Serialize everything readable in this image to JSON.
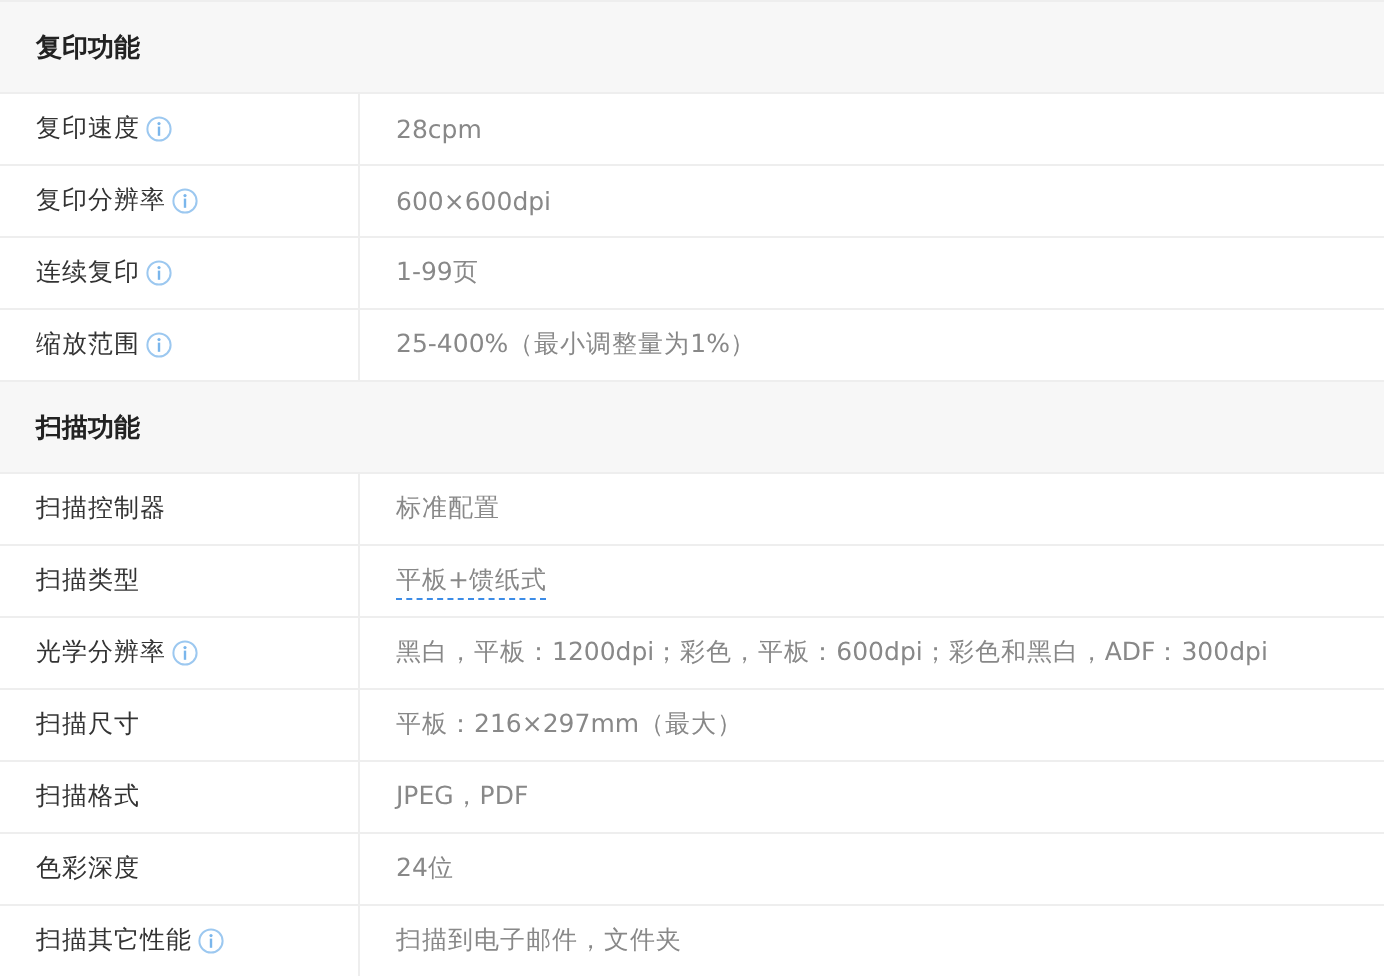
{
  "sections": [
    {
      "title": "复印功能",
      "rows": [
        {
          "label": "复印速度",
          "info": true,
          "kind": "text",
          "value": "28cpm"
        },
        {
          "label": "复印分辨率",
          "info": true,
          "kind": "text",
          "value": "600×600dpi"
        },
        {
          "label": "连续复印",
          "info": true,
          "kind": "text",
          "value": "1-99页"
        },
        {
          "label": "缩放范围",
          "info": true,
          "kind": "text",
          "value": "25-400%（最小调整量为1%）"
        }
      ]
    },
    {
      "title": "扫描功能",
      "rows": [
        {
          "label": "扫描控制器",
          "info": false,
          "kind": "text",
          "value": "标准配置"
        },
        {
          "label": "扫描类型",
          "info": false,
          "kind": "link",
          "value": "平板+馈纸式"
        },
        {
          "label": "光学分辨率",
          "info": true,
          "kind": "text",
          "value": "黑白，平板：1200dpi；彩色，平板：600dpi；彩色和黑白，ADF：300dpi"
        },
        {
          "label": "扫描尺寸",
          "info": false,
          "kind": "text",
          "value": "平板：216×297mm（最大）"
        },
        {
          "label": "扫描格式",
          "info": false,
          "kind": "text",
          "value": "JPEG，PDF"
        },
        {
          "label": "色彩深度",
          "info": false,
          "kind": "text",
          "value": "24位"
        },
        {
          "label": "扫描其它性能",
          "info": true,
          "kind": "text",
          "value": "扫描到电子邮件，文件夹"
        }
      ]
    }
  ]
}
